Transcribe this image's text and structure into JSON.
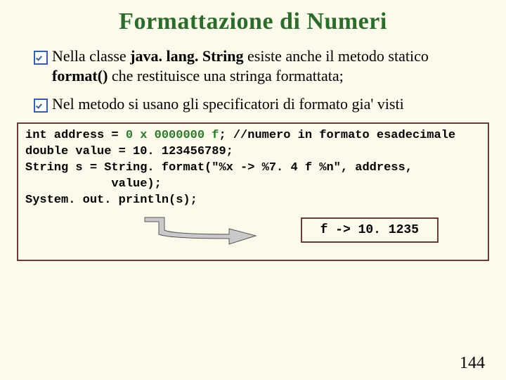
{
  "title": "Formattazione di Numeri",
  "bullets": [
    {
      "pre": "Nella classe ",
      "bold1": "java. lang. String",
      "mid1": " esiste anche il metodo statico ",
      "bold2": "format()",
      "mid2": " che restituisce una stringa formattata;"
    },
    {
      "pre": "Nel metodo si usano gli specificatori di formato gia' visti",
      "bold1": "",
      "mid1": "",
      "bold2": "",
      "mid2": ""
    }
  ],
  "code": {
    "l1a": "int address = ",
    "l1b": "0 x 0000000 f",
    "l1c": "; //numero in formato esadecimale",
    "l2": "double value = 10. 123456789;",
    "l3": "",
    "l4": "String s = String. format(\"%x -> %7. 4 f %n\", address,",
    "l5": "            value);",
    "l6": "",
    "l7": "System. out. println(s);"
  },
  "output": "f -> 10. 1235",
  "pageNumber": "144"
}
